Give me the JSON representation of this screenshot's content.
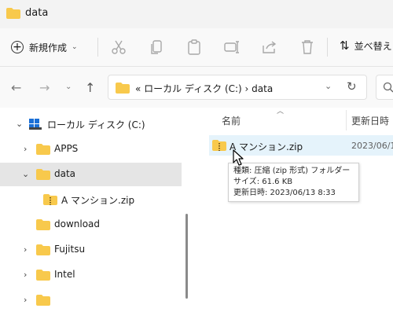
{
  "window": {
    "title": "data"
  },
  "toolbar": {
    "new_label": "新規作成",
    "sort_label": "並べ替え",
    "icons": [
      "cut-icon",
      "copy-icon",
      "paste-icon",
      "rename-icon",
      "share-icon",
      "delete-icon"
    ]
  },
  "address": {
    "path_text": "«  ローカル ディスク (C:)  ›  data"
  },
  "nav_tree": {
    "root_label": "ローカル ディスク (C:)",
    "items": [
      {
        "label": "APPS"
      },
      {
        "label": "data"
      },
      {
        "label": "A マンション.zip"
      },
      {
        "label": "download"
      },
      {
        "label": "Fujitsu"
      },
      {
        "label": "Intel"
      }
    ]
  },
  "columns": {
    "name": "名前",
    "modified": "更新日時"
  },
  "files": [
    {
      "name": "A マンション.zip",
      "date": "2023/06/1"
    }
  ],
  "tooltip": {
    "type": "種類: 圧縮 (zip 形式) フォルダー",
    "size": "サイズ: 61.6 KB",
    "modified": "更新日時: 2023/06/13 8:33"
  },
  "colors": {
    "folder": "#f8c94c",
    "selected_row": "#e5e5e5",
    "hover_row": "#e5f3fb"
  }
}
